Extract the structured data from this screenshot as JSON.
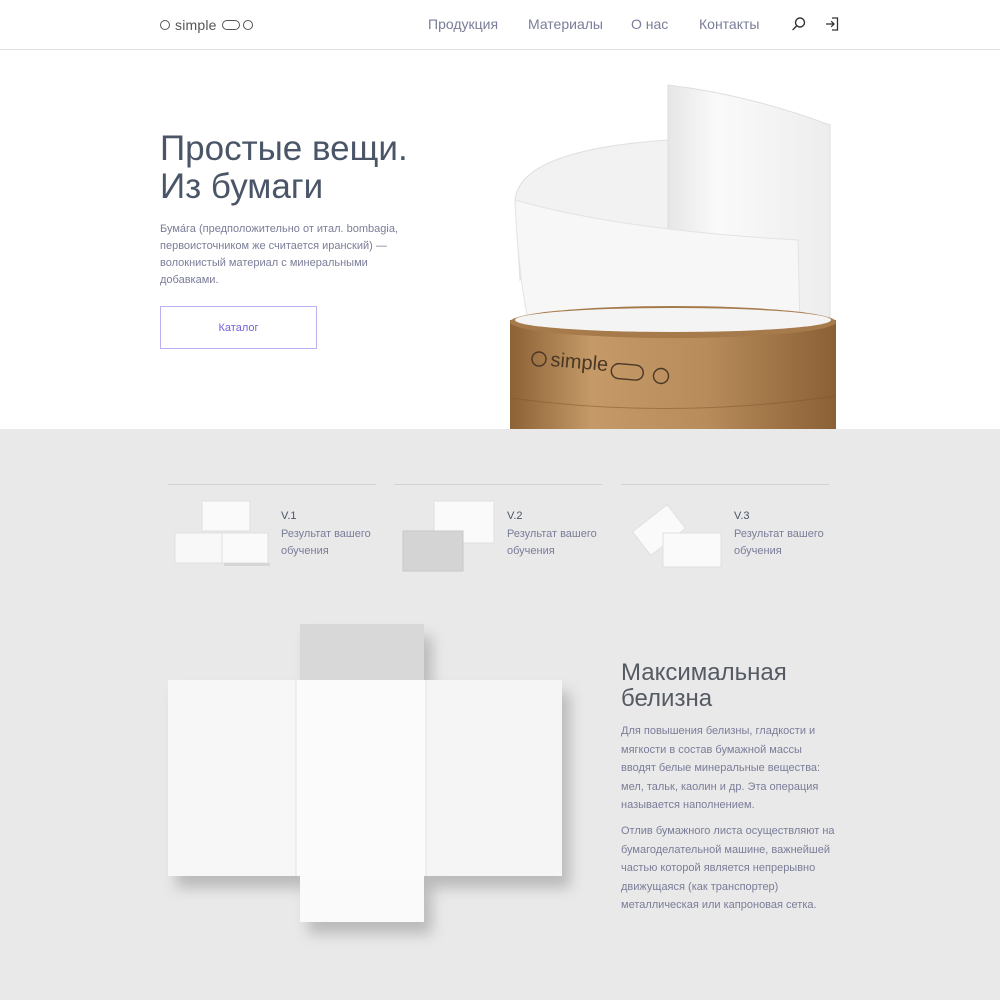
{
  "header": {
    "logo": {
      "word": "simple",
      "icons": [
        "circle-icon",
        "pill-icon",
        "circle-icon"
      ]
    },
    "nav": [
      "Продукция",
      "Материалы",
      "О нас",
      "Контакты"
    ],
    "icons": [
      "search-icon",
      "login-icon"
    ]
  },
  "hero": {
    "title_line1": "Простые вещи.",
    "title_line2": "Из бумаги",
    "text": "Бума́га (предположительно от итал. bombagia, первоисточником же считается иранский) — волокнистый материал с минеральными добавками.",
    "button": "Каталог",
    "tube_label": "simple"
  },
  "versions": [
    {
      "title": "V.1",
      "desc": "Результат вашего обучения"
    },
    {
      "title": "V.2",
      "desc": "Результат вашего обучения"
    },
    {
      "title": "V.3",
      "desc": "Результат вашего обучения"
    }
  ],
  "feature": {
    "title_line1": "Максимальная",
    "title_line2": "белизна",
    "p1": "Для повышения белизны, гладкости и мягкости в состав бумажной массы вводят белые минеральные вещества: мел, тальк, каолин и др. Эта операция называется наполнением.",
    "p2": "Отлив бумажного листа осуществляют на бумагоделательной машине, важнейшей частью которой является непрерывно движущаяся (как транспортер) металлическая или капроновая сетка."
  },
  "colors": {
    "accent": "#6f64d8",
    "accent_border": "#b9b2f0",
    "text_dark": "#4a5568",
    "text_muted": "#7a7d98",
    "section_bg": "#e9e9ea",
    "kraft": "#b98d5e"
  }
}
